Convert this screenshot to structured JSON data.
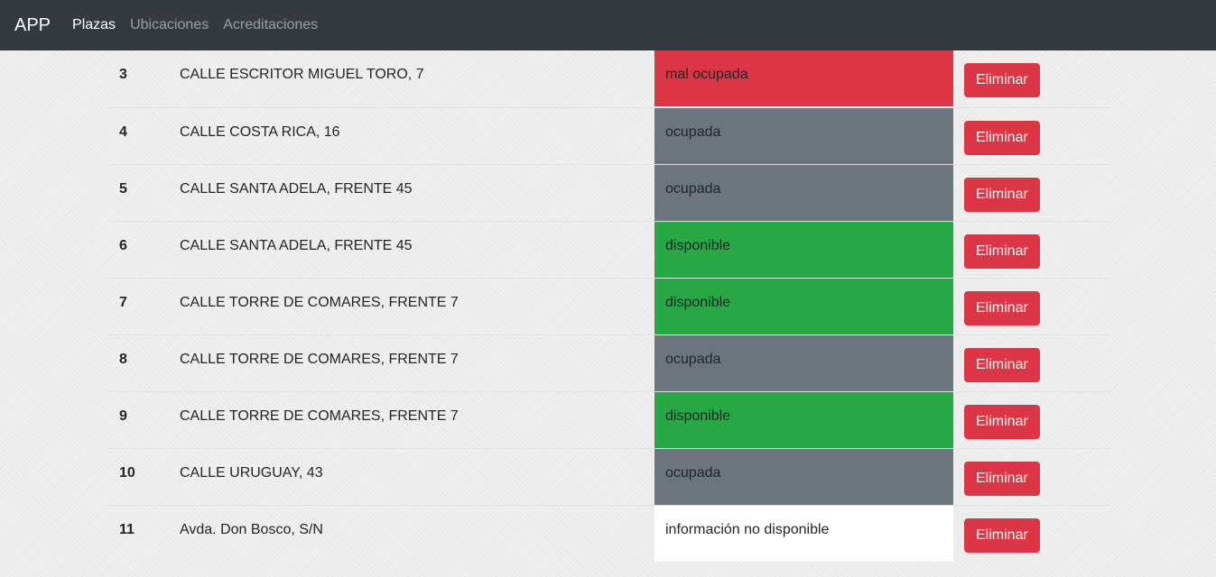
{
  "navbar": {
    "brand": "APP",
    "links": [
      {
        "label": "Plazas"
      },
      {
        "label": "Ubicaciones"
      },
      {
        "label": "Acreditaciones"
      }
    ]
  },
  "colors": {
    "mal ocupada": "#dc3545",
    "ocupada": "#6c757d",
    "disponible": "#28a745",
    "información no disponible": "#ffffff"
  },
  "rows": [
    {
      "num": "3",
      "address": "CALLE ESCRITOR MIGUEL TORO, 7",
      "status": "mal ocupada",
      "action": "Eliminar"
    },
    {
      "num": "4",
      "address": "CALLE COSTA RICA, 16",
      "status": "ocupada",
      "action": "Eliminar"
    },
    {
      "num": "5",
      "address": "CALLE SANTA ADELA, FRENTE 45",
      "status": "ocupada",
      "action": "Eliminar"
    },
    {
      "num": "6",
      "address": "CALLE SANTA ADELA, FRENTE 45",
      "status": "disponible",
      "action": "Eliminar"
    },
    {
      "num": "7",
      "address": "CALLE TORRE DE COMARES, FRENTE 7",
      "status": "disponible",
      "action": "Eliminar"
    },
    {
      "num": "8",
      "address": "CALLE TORRE DE COMARES, FRENTE 7",
      "status": "ocupada",
      "action": "Eliminar"
    },
    {
      "num": "9",
      "address": "CALLE TORRE DE COMARES, FRENTE 7",
      "status": "disponible",
      "action": "Eliminar"
    },
    {
      "num": "10",
      "address": "CALLE URUGUAY, 43",
      "status": "ocupada",
      "action": "Eliminar"
    },
    {
      "num": "11",
      "address": "Avda. Don Bosco, S/N",
      "status": "información no disponible",
      "action": "Eliminar"
    }
  ]
}
